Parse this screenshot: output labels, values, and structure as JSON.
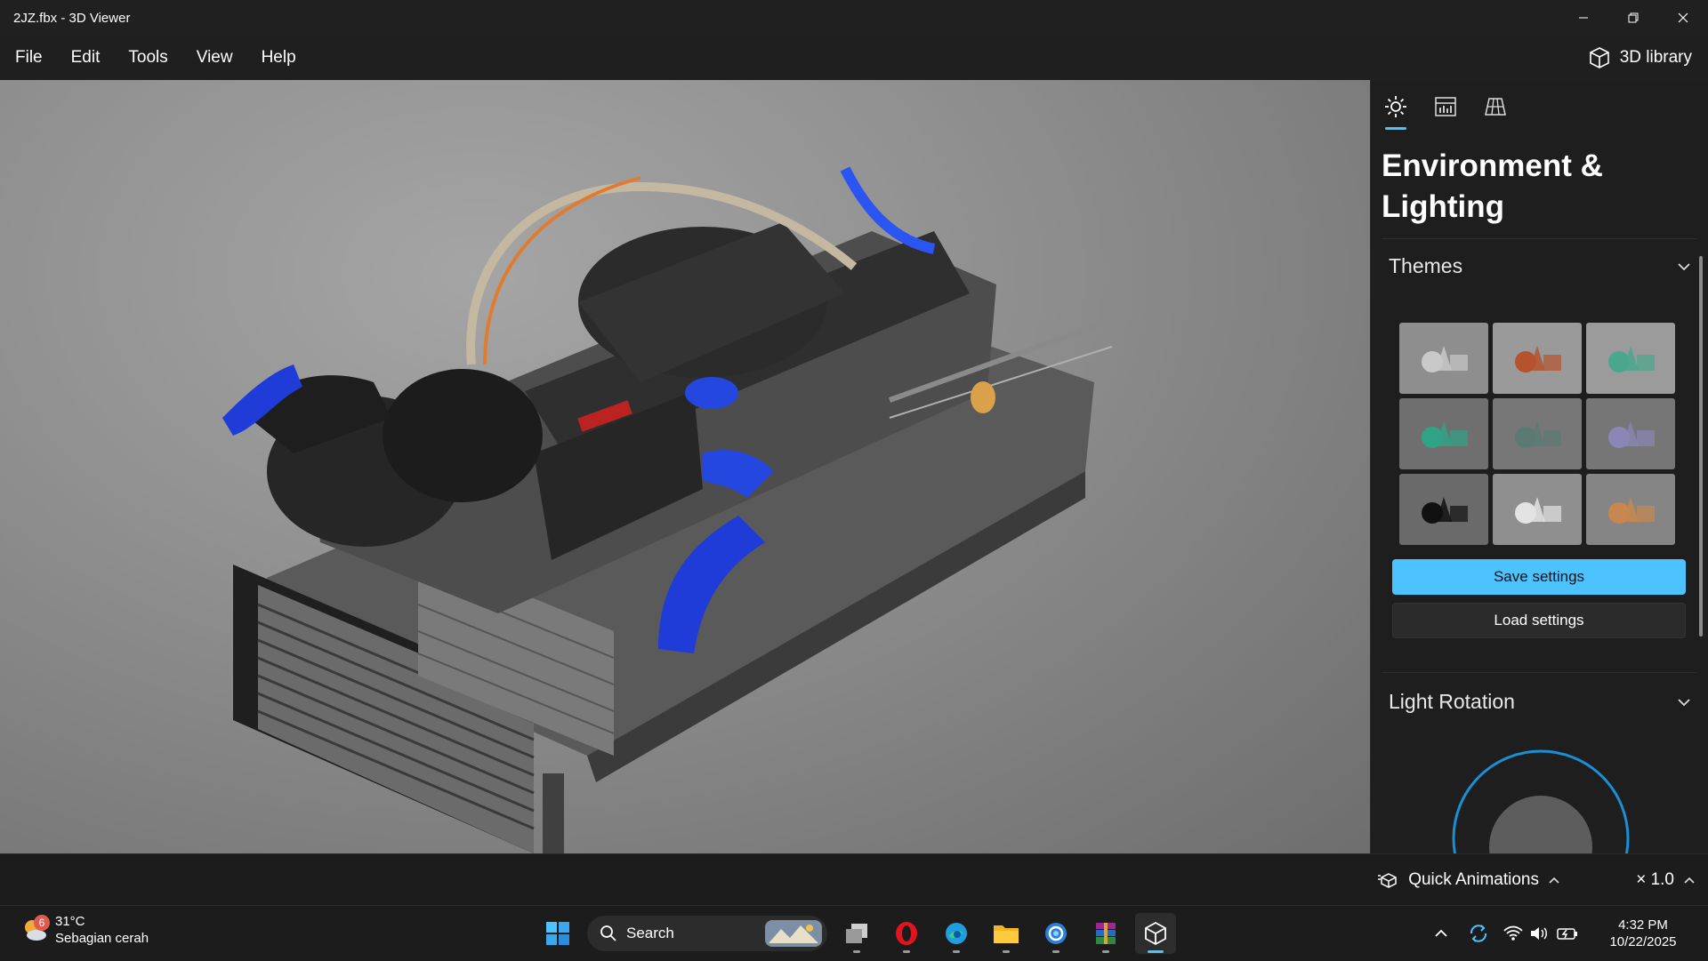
{
  "window": {
    "title": "2JZ.fbx - 3D Viewer",
    "controls": [
      "minimize-icon",
      "restore-icon",
      "close-icon"
    ]
  },
  "menu": {
    "items": [
      "File",
      "Edit",
      "Tools",
      "View",
      "Help"
    ],
    "library_label": "3D library"
  },
  "viewport": {
    "model": "2JZ engine"
  },
  "panel": {
    "tabs": [
      {
        "icon": "sun-icon",
        "active": true
      },
      {
        "icon": "stats-icon",
        "active": false
      },
      {
        "icon": "grid-icon",
        "active": false
      }
    ],
    "title_line1": "Environment &",
    "title_line2": "Lighting",
    "themes_label": "Themes",
    "themes": [
      {
        "bg": "#8e8e8e",
        "fg": "#c9c9c9"
      },
      {
        "bg": "#9a9a9a",
        "fg": "#b5532e"
      },
      {
        "bg": "#9b9b9b",
        "fg": "#4aa78e"
      },
      {
        "bg": "#6f6f6f",
        "fg": "#2fa386"
      },
      {
        "bg": "#777777",
        "fg": "#5c7a74"
      },
      {
        "bg": "#767676",
        "fg": "#8a86b5"
      },
      {
        "bg": "#6a6a6a",
        "fg": "#111111"
      },
      {
        "bg": "#8f8f8f",
        "fg": "#e3e3e3"
      },
      {
        "bg": "#858585",
        "fg": "#c8874e"
      }
    ],
    "save_label": "Save settings",
    "load_label": "Load settings",
    "light_rotation_label": "Light Rotation",
    "accent": "#4cc2ff"
  },
  "appbar": {
    "quick_animations": "Quick Animations",
    "speed": "× 1.0"
  },
  "taskbar": {
    "weather_badge": "6",
    "temperature": "31°C",
    "condition": "Sebagian cerah",
    "search_placeholder": "Search",
    "apps": [
      "start-icon",
      "task-view-icon",
      "opera-icon",
      "edge-icon",
      "file-explorer-icon",
      "browser-icon",
      "winrar-icon",
      "3d-viewer-icon"
    ],
    "time": "4:32 PM",
    "date": "10/22/2025"
  }
}
